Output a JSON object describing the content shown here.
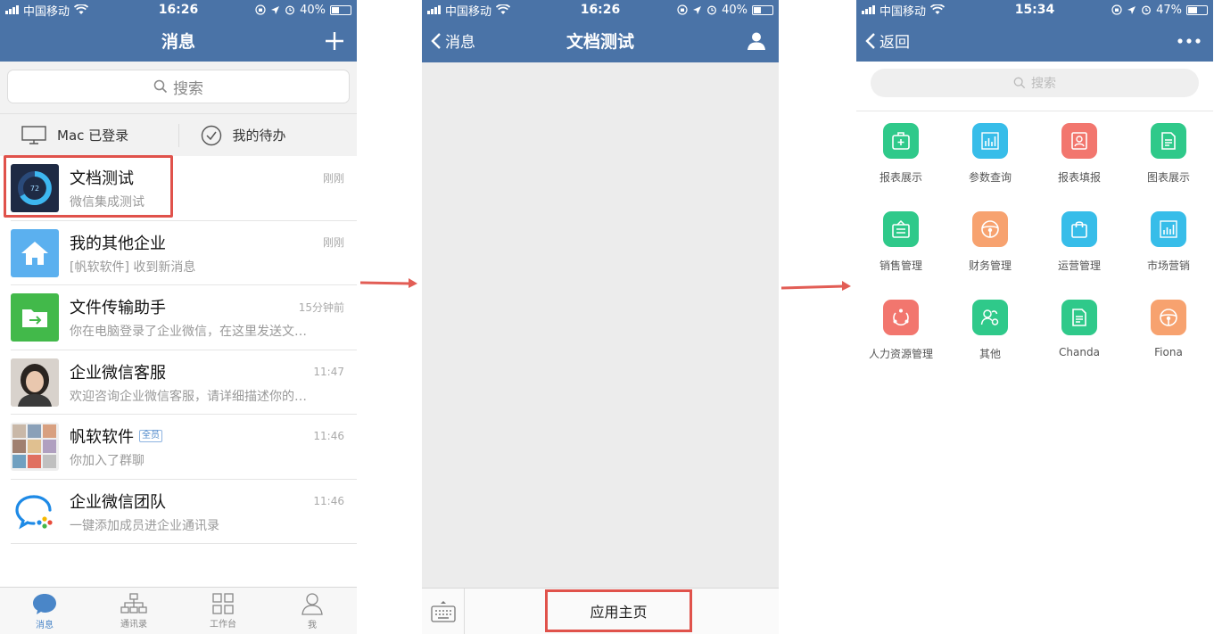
{
  "screen1": {
    "status": {
      "carrier": "中国移动",
      "time": "16:26",
      "battery": "40%",
      "battery_level": 0.4
    },
    "title": "消息",
    "search_placeholder": "搜索",
    "quick": {
      "mac_label": "Mac 已登录",
      "todo_label": "我的待办"
    },
    "chats": [
      {
        "name": "文档测试",
        "message": "微信集成测试",
        "time": "刚刚",
        "avatar": "gauge-avatar-icon",
        "gauge_value": "72"
      },
      {
        "name": "我的其他企业",
        "message": "[帆软软件] 收到新消息",
        "time": "刚刚",
        "avatar": "home-icon"
      },
      {
        "name": "文件传输助手",
        "message": "你在电脑登录了企业微信，在这里发送文…",
        "time": "15分钟前",
        "avatar": "folder-transfer-icon"
      },
      {
        "name": "企业微信客服",
        "message": "欢迎咨询企业微信客服，请详细描述你的…",
        "time": "11:47",
        "avatar": "user-photo"
      },
      {
        "name": "帆软软件",
        "tag": "全员",
        "message": "你加入了群聊",
        "time": "11:46",
        "avatar": "group-collage-avatar"
      },
      {
        "name": "企业微信团队",
        "message": "一键添加成员进企业通讯录",
        "time": "11:46",
        "avatar": "wework-logo-icon"
      }
    ],
    "tabs": [
      {
        "label": "消息",
        "active": true
      },
      {
        "label": "通讯录"
      },
      {
        "label": "工作台"
      },
      {
        "label": "我"
      }
    ]
  },
  "screen2": {
    "status": {
      "carrier": "中国移动",
      "time": "16:26",
      "battery": "40%",
      "battery_level": 0.4
    },
    "back_label": "消息",
    "title": "文档测试",
    "app_home_label": "应用主页"
  },
  "screen3": {
    "status": {
      "carrier": "中国移动",
      "time": "15:34",
      "battery": "47%",
      "battery_level": 0.47
    },
    "back_label": "返回",
    "search_placeholder": "搜索",
    "apps": [
      {
        "label": "报表展示",
        "color": "#2fc98a",
        "icon": "report-plus-icon"
      },
      {
        "label": "参数查询",
        "color": "#37bde9",
        "icon": "bar-chart-icon"
      },
      {
        "label": "报表填报",
        "color": "#f2766e",
        "icon": "fill-form-icon"
      },
      {
        "label": "图表展示",
        "color": "#2fc98a",
        "icon": "document-icon"
      },
      {
        "label": "销售管理",
        "color": "#2fc98a",
        "icon": "sales-box-icon"
      },
      {
        "label": "财务管理",
        "color": "#f7a26f",
        "icon": "steering-wheel-icon"
      },
      {
        "label": "运营管理",
        "color": "#37bde9",
        "icon": "shopping-bag-icon"
      },
      {
        "label": "市场营销",
        "color": "#37bde9",
        "icon": "market-chart-icon"
      },
      {
        "label": "人力资源管理",
        "color": "#f2766e",
        "icon": "hr-cycle-icon"
      },
      {
        "label": "其他",
        "color": "#2fc98a",
        "icon": "users-gear-icon"
      },
      {
        "label": "Chanda",
        "color": "#2fc98a",
        "icon": "document-icon"
      },
      {
        "label": "Fiona",
        "color": "#f7a26f",
        "icon": "steering-wheel-icon"
      }
    ]
  }
}
